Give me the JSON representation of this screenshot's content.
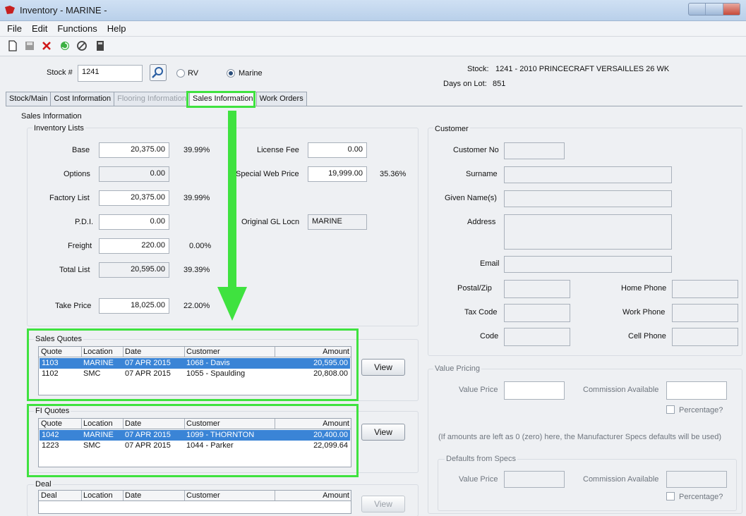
{
  "window": {
    "title": "Inventory - MARINE -"
  },
  "menu": [
    "File",
    "Edit",
    "Functions",
    "Help"
  ],
  "header": {
    "stock_label": "Stock #",
    "stock_value": "1241",
    "radio_rv": "RV",
    "radio_marine": "Marine",
    "selected_radio": "Marine",
    "stock_desc_label": "Stock:",
    "stock_desc_value": "1241 - 2010 PRINCECRAFT VERSAILLES 26 WK",
    "days_label": "Days on Lot:",
    "days_value": "851"
  },
  "tabs": [
    {
      "label": "Stock/Main",
      "state": "normal"
    },
    {
      "label": "Cost Information",
      "state": "normal"
    },
    {
      "label": "Flooring Information",
      "state": "disabled"
    },
    {
      "label": "Sales Information",
      "state": "active"
    },
    {
      "label": "Work Orders",
      "state": "normal"
    }
  ],
  "sales": {
    "section_title": "Sales Information",
    "inventory_title": "Inventory Lists",
    "base_label": "Base",
    "base_value": "20,375.00",
    "base_pct": "39.99%",
    "options_label": "Options",
    "options_value": "0.00",
    "factory_label": "Factory List",
    "factory_value": "20,375.00",
    "factory_pct": "39.99%",
    "pdi_label": "P.D.I.",
    "pdi_value": "0.00",
    "freight_label": "Freight",
    "freight_value": "220.00",
    "freight_pct": "0.00%",
    "total_label": "Total List",
    "total_value": "20,595.00",
    "total_pct": "39.39%",
    "take_label": "Take Price",
    "take_value": "18,025.00",
    "take_pct": "22.00%",
    "license_label": "License Fee",
    "license_value": "0.00",
    "web_label": "Special Web Price",
    "web_value": "19,999.00",
    "web_pct": "35.36%",
    "gl_label": "Original GL Locn",
    "gl_value": "MARINE"
  },
  "sales_quotes": {
    "title": "Sales Quotes",
    "columns": [
      "Quote",
      "Location",
      "Date",
      "Customer",
      "Amount"
    ],
    "rows": [
      {
        "quote": "1103",
        "location": "MARINE",
        "date": "07 APR 2015",
        "customer": "1068 - Davis",
        "amount": "20,595.00",
        "selected": true
      },
      {
        "quote": "1102",
        "location": "SMC",
        "date": "07 APR 2015",
        "customer": "1055 - Spaulding",
        "amount": "20,808.00",
        "selected": false
      }
    ],
    "view_label": "View"
  },
  "fi_quotes": {
    "title": "FI Quotes",
    "columns": [
      "Quote",
      "Location",
      "Date",
      "Customer",
      "Amount"
    ],
    "rows": [
      {
        "quote": "1042",
        "location": "MARINE",
        "date": "07 APR 2015",
        "customer": "1099 - THORNTON",
        "amount": "20,400.00",
        "selected": true
      },
      {
        "quote": "1223",
        "location": "SMC",
        "date": "07 APR 2015",
        "customer": "1044 - Parker",
        "amount": "22,099.64",
        "selected": false
      }
    ],
    "view_label": "View"
  },
  "deal": {
    "title": "Deal",
    "columns": [
      "Deal",
      "Location",
      "Date",
      "Customer",
      "Amount"
    ],
    "view_label": "View"
  },
  "customer": {
    "title": "Customer",
    "customer_no": "Customer No",
    "surname": "Surname",
    "given": "Given Name(s)",
    "address": "Address",
    "email": "Email",
    "postal": "Postal/Zip",
    "tax": "Tax Code",
    "code": "Code",
    "home_phone": "Home Phone",
    "work_phone": "Work Phone",
    "cell_phone": "Cell Phone"
  },
  "value_pricing": {
    "title": "Value Pricing",
    "value_price": "Value Price",
    "commission": "Commission Available",
    "percentage": "Percentage?",
    "note": "(If amounts are left as 0 (zero) here, the Manufacturer Specs defaults will be used)",
    "defaults_title": "Defaults from Specs",
    "d_value_price": "Value Price",
    "d_commission": "Commission Available",
    "d_percentage": "Percentage?"
  },
  "annotation_color": "#3fe23f"
}
